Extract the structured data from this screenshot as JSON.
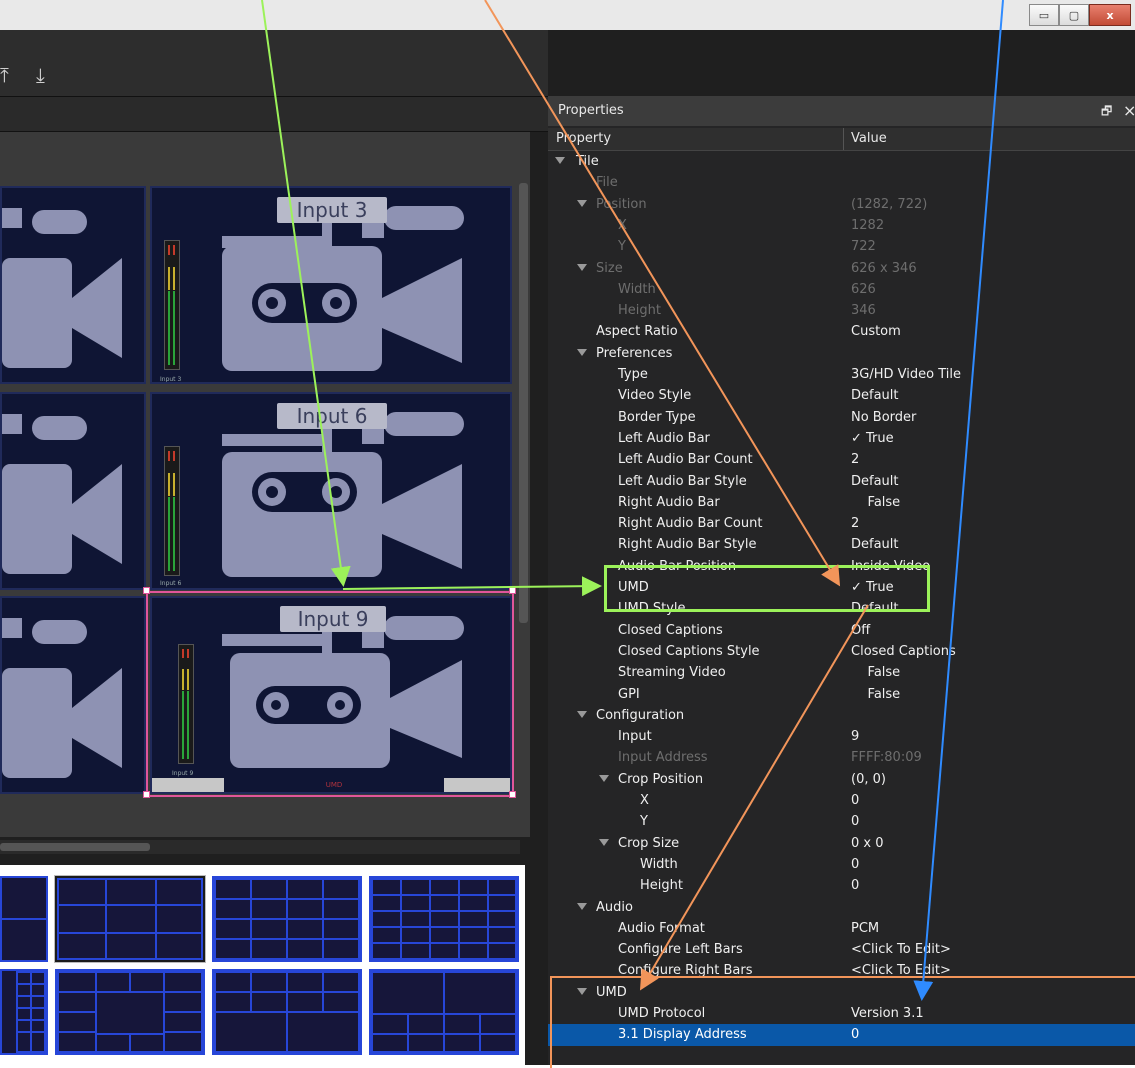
{
  "window": {
    "min_glyph": "▭",
    "max_glyph": "▢",
    "close_glyph": "x"
  },
  "toolbar": {
    "up_glyph": "⤒",
    "down_glyph": "⤓"
  },
  "tiles": [
    {
      "label": "Input 3",
      "small": "Input 3"
    },
    {
      "label": "Input 6",
      "small": "Input 6"
    },
    {
      "label": "Input 9",
      "small": "Input 9",
      "footer": "UMD"
    }
  ],
  "properties": {
    "title": "Properties",
    "float_glyph": "🗗",
    "close_glyph": "×",
    "col_property": "Property",
    "col_value": "Value",
    "rows": [
      {
        "label": "Tile",
        "value": "",
        "depth": 0,
        "expand": true,
        "dim": false
      },
      {
        "label": "File",
        "value": "",
        "depth": 1,
        "expand": false,
        "dim": true
      },
      {
        "label": "Position",
        "value": "(1282, 722)",
        "depth": 1,
        "expand": true,
        "dim": true
      },
      {
        "label": "X",
        "value": "1282",
        "depth": 2,
        "expand": false,
        "dim": true
      },
      {
        "label": "Y",
        "value": "722",
        "depth": 2,
        "expand": false,
        "dim": true
      },
      {
        "label": "Size",
        "value": "626 x 346",
        "depth": 1,
        "expand": true,
        "dim": true
      },
      {
        "label": "Width",
        "value": "626",
        "depth": 2,
        "expand": false,
        "dim": true
      },
      {
        "label": "Height",
        "value": "346",
        "depth": 2,
        "expand": false,
        "dim": true
      },
      {
        "label": "Aspect Ratio",
        "value": "Custom",
        "depth": 1,
        "expand": false,
        "dim": false
      },
      {
        "label": "Preferences",
        "value": "",
        "depth": 1,
        "expand": true,
        "dim": false
      },
      {
        "label": "Type",
        "value": "3G/HD Video Tile",
        "depth": 2,
        "expand": false,
        "dim": false
      },
      {
        "label": "Video Style",
        "value": "Default",
        "depth": 2,
        "expand": false,
        "dim": false
      },
      {
        "label": "Border Type",
        "value": "No Border",
        "depth": 2,
        "expand": false,
        "dim": false
      },
      {
        "label": "Left Audio Bar",
        "value": "✓ True",
        "depth": 2,
        "expand": false,
        "dim": false
      },
      {
        "label": "Left Audio Bar Count",
        "value": "2",
        "depth": 2,
        "expand": false,
        "dim": false
      },
      {
        "label": "Left Audio Bar Style",
        "value": "Default",
        "depth": 2,
        "expand": false,
        "dim": false
      },
      {
        "label": "Right Audio Bar",
        "value": "    False",
        "depth": 2,
        "expand": false,
        "dim": false
      },
      {
        "label": "Right Audio Bar Count",
        "value": "2",
        "depth": 2,
        "expand": false,
        "dim": false
      },
      {
        "label": "Right Audio Bar Style",
        "value": "Default",
        "depth": 2,
        "expand": false,
        "dim": false
      },
      {
        "label": "Audio Bar Position",
        "value": "Inside Video",
        "depth": 2,
        "expand": false,
        "dim": false
      },
      {
        "label": "UMD",
        "value": "✓ True",
        "depth": 2,
        "expand": false,
        "dim": false
      },
      {
        "label": "UMD Style",
        "value": "Default",
        "depth": 2,
        "expand": false,
        "dim": false
      },
      {
        "label": "Closed Captions",
        "value": "Off",
        "depth": 2,
        "expand": false,
        "dim": false
      },
      {
        "label": "Closed Captions Style",
        "value": "Closed Captions",
        "depth": 2,
        "expand": false,
        "dim": false
      },
      {
        "label": "Streaming Video",
        "value": "    False",
        "depth": 2,
        "expand": false,
        "dim": false
      },
      {
        "label": "GPI",
        "value": "    False",
        "depth": 2,
        "expand": false,
        "dim": false
      },
      {
        "label": "Configuration",
        "value": "",
        "depth": 1,
        "expand": true,
        "dim": false
      },
      {
        "label": "Input",
        "value": "9",
        "depth": 2,
        "expand": false,
        "dim": false
      },
      {
        "label": "Input Address",
        "value": "FFFF:80:09",
        "depth": 2,
        "expand": false,
        "dim": true
      },
      {
        "label": "Crop Position",
        "value": "(0, 0)",
        "depth": 2,
        "expand": true,
        "dim": false
      },
      {
        "label": "X",
        "value": "0",
        "depth": 3,
        "expand": false,
        "dim": false
      },
      {
        "label": "Y",
        "value": "0",
        "depth": 3,
        "expand": false,
        "dim": false
      },
      {
        "label": "Crop Size",
        "value": "0 x 0",
        "depth": 2,
        "expand": true,
        "dim": false
      },
      {
        "label": "Width",
        "value": "0",
        "depth": 3,
        "expand": false,
        "dim": false
      },
      {
        "label": "Height",
        "value": "0",
        "depth": 3,
        "expand": false,
        "dim": false
      },
      {
        "label": "Audio",
        "value": "",
        "depth": 1,
        "expand": true,
        "dim": false
      },
      {
        "label": "Audio Format",
        "value": "PCM",
        "depth": 2,
        "expand": false,
        "dim": false
      },
      {
        "label": "Configure Left Bars",
        "value": "<Click To Edit>",
        "depth": 2,
        "expand": false,
        "dim": false
      },
      {
        "label": "Configure Right Bars",
        "value": "<Click To Edit>",
        "depth": 2,
        "expand": false,
        "dim": false
      },
      {
        "label": "UMD",
        "value": "",
        "depth": 1,
        "expand": true,
        "dim": false
      },
      {
        "label": "UMD Protocol",
        "value": "Version 3.1",
        "depth": 2,
        "expand": false,
        "dim": false
      },
      {
        "label": "3.1 Display Address",
        "value": "0",
        "depth": 2,
        "expand": false,
        "dim": false,
        "selected": true
      }
    ]
  },
  "colors": {
    "accent_green": "#9cf25a",
    "accent_orange": "#f2955a",
    "accent_blue": "#2f8bff",
    "selection_blue": "#0a58a8",
    "tile_border": "#e0569a"
  }
}
